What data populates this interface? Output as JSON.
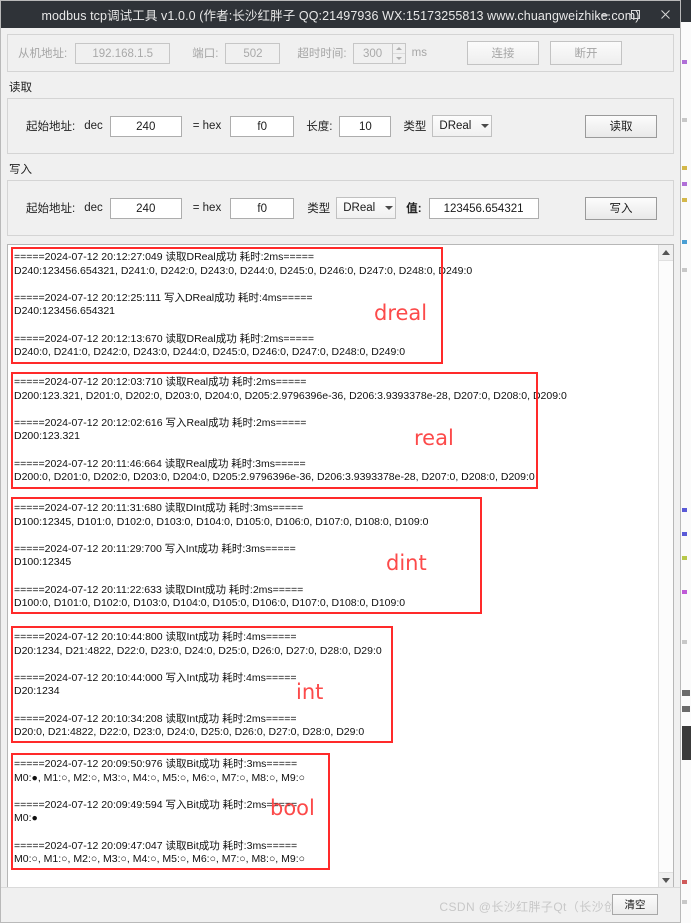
{
  "window": {
    "title": "modbus tcp调试工具 v1.0.0 (作者:长沙红胖子 QQ:21497936 WX:15173255813 www.chuangweizhike.com)",
    "minimize_label": "minimize",
    "maximize_label": "maximize",
    "close_label": "close"
  },
  "connection": {
    "slave_label": "从机地址:",
    "slave_value": "192.168.1.5",
    "port_label": "端口:",
    "port_value": "502",
    "timeout_label": "超时时间:",
    "timeout_value": "300",
    "timeout_unit": "ms",
    "connect_label": "连接",
    "disconnect_label": "断开"
  },
  "read": {
    "group_title": "读取",
    "addr_label": "起始地址:",
    "dec_label": "dec",
    "dec_value": "240",
    "eq_hex_label": "= hex",
    "hex_value": "f0",
    "length_label": "长度:",
    "length_value": "10",
    "type_label": "类型",
    "type_value": "DReal",
    "button_label": "读取"
  },
  "write": {
    "group_title": "写入",
    "addr_label": "起始地址:",
    "dec_label": "dec",
    "dec_value": "240",
    "eq_hex_label": "= hex",
    "hex_value": "f0",
    "type_label": "类型",
    "type_value": "DReal",
    "value_label": "值:",
    "value_value": "123456.654321",
    "button_label": "写入"
  },
  "log": {
    "blocks": [
      {
        "annotation": "dreal",
        "text": "=====2024-07-12 20:12:27:049 读取DReal成功 耗时:2ms=====\nD240:123456.654321, D241:0, D242:0, D243:0, D244:0, D245:0, D246:0, D247:0, D248:0, D249:0\n\n=====2024-07-12 20:12:25:111 写入DReal成功 耗时:4ms=====\nD240:123456.654321\n\n=====2024-07-12 20:12:13:670 读取DReal成功 耗时:2ms=====\nD240:0, D241:0, D242:0, D243:0, D244:0, D245:0, D246:0, D247:0, D248:0, D249:0"
      },
      {
        "annotation": "real",
        "text": "=====2024-07-12 20:12:03:710 读取Real成功 耗时:2ms=====\nD200:123.321, D201:0, D202:0, D203:0, D204:0, D205:2.9796396e-36, D206:3.9393378e-28, D207:0, D208:0, D209:0\n\n=====2024-07-12 20:12:02:616 写入Real成功 耗时:2ms=====\nD200:123.321\n\n=====2024-07-12 20:11:46:664 读取Real成功 耗时:3ms=====\nD200:0, D201:0, D202:0, D203:0, D204:0, D205:2.9796396e-36, D206:3.9393378e-28, D207:0, D208:0, D209:0"
      },
      {
        "annotation": "dint",
        "text": "=====2024-07-12 20:11:31:680 读取DInt成功 耗时:3ms=====\nD100:12345, D101:0, D102:0, D103:0, D104:0, D105:0, D106:0, D107:0, D108:0, D109:0\n\n=====2024-07-12 20:11:29:700 写入Int成功 耗时:3ms=====\nD100:12345\n\n=====2024-07-12 20:11:22:633 读取DInt成功 耗时:2ms=====\nD100:0, D101:0, D102:0, D103:0, D104:0, D105:0, D106:0, D107:0, D108:0, D109:0"
      },
      {
        "annotation": "int",
        "text": "=====2024-07-12 20:10:44:800 读取Int成功 耗时:4ms=====\nD20:1234, D21:4822, D22:0, D23:0, D24:0, D25:0, D26:0, D27:0, D28:0, D29:0\n\n=====2024-07-12 20:10:44:000 写入Int成功 耗时:4ms=====\nD20:1234\n\n=====2024-07-12 20:10:34:208 读取Int成功 耗时:2ms=====\nD20:0, D21:4822, D22:0, D23:0, D24:0, D25:0, D26:0, D27:0, D28:0, D29:0"
      },
      {
        "annotation": "bool",
        "text": "=====2024-07-12 20:09:50:976 读取Bit成功 耗时:3ms=====\nM0:●, M1:○, M2:○, M3:○, M4:○, M5:○, M6:○, M7:○, M8:○, M9:○\n\n=====2024-07-12 20:09:49:594 写入Bit成功 耗时:2ms=====\nM0:●\n\n=====2024-07-12 20:09:47:047 读取Bit成功 耗时:3ms=====\nM0:○, M1:○, M2:○, M3:○, M4:○, M5:○, M6:○, M7:○, M8:○, M9:○"
      }
    ],
    "scrollbar_up_label": "scroll up",
    "scrollbar_down_label": "scroll down"
  },
  "status": {
    "watermark": "CSDN @长沙红胖子Qt（长沙创微智科）",
    "clear_button_label": "清空"
  },
  "colors": {
    "titlebar_bg": "#2f3338",
    "annotation_red": "#fc4a4a",
    "window_bg": "#f0f0f0"
  }
}
